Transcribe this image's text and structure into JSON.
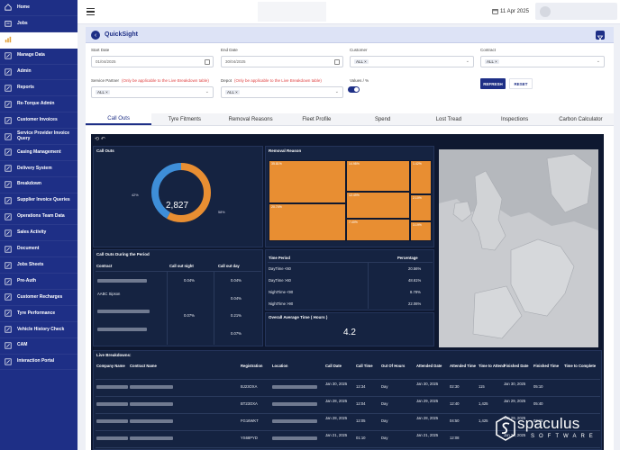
{
  "sidebar": {
    "items": [
      {
        "label": "Home",
        "icon": "home-icon"
      },
      {
        "label": "Jobs",
        "icon": "jobs-icon"
      },
      {
        "label": "",
        "icon": "chart-icon",
        "active": true
      },
      {
        "label": "Manage Data",
        "icon": "edit-icon"
      },
      {
        "label": "Admin",
        "icon": "edit-icon"
      },
      {
        "label": "Reports",
        "icon": "edit-icon"
      },
      {
        "label": "Re-Torque Admin",
        "icon": "edit-icon"
      },
      {
        "label": "Customer Invoices",
        "icon": "edit-icon"
      },
      {
        "label": "Service Provider Invoice Query",
        "icon": "edit-icon"
      },
      {
        "label": "Casing Management",
        "icon": "edit-icon"
      },
      {
        "label": "Delivery System",
        "icon": "edit-icon"
      },
      {
        "label": "Breakdown",
        "icon": "edit-icon"
      },
      {
        "label": "Supplier Invoice Queries",
        "icon": "edit-icon"
      },
      {
        "label": "Operations Team Data",
        "icon": "edit-icon"
      },
      {
        "label": "Sales Activity",
        "icon": "edit-icon"
      },
      {
        "label": "Document",
        "icon": "edit-icon"
      },
      {
        "label": "Jobs Sheets",
        "icon": "edit-icon"
      },
      {
        "label": "Pre-Auth",
        "icon": "edit-icon"
      },
      {
        "label": "Customer Recharges",
        "icon": "edit-icon"
      },
      {
        "label": "Tyre Performance",
        "icon": "edit-icon"
      },
      {
        "label": "Vehicle History Check",
        "icon": "edit-icon"
      },
      {
        "label": "CAM",
        "icon": "edit-icon"
      },
      {
        "label": "Interaction Portal",
        "icon": "edit-icon"
      }
    ]
  },
  "topbar": {
    "date": "11 Apr 2025"
  },
  "quicksight": {
    "title": "QuickSight",
    "filters": {
      "start_date": {
        "label": "Start Date",
        "value": "01/04/2025"
      },
      "end_date": {
        "label": "End Date",
        "value": "30/04/2025"
      },
      "customer": {
        "label": "Customer",
        "chip": "ALL"
      },
      "contract": {
        "label": "Contract",
        "chip": "ALL"
      },
      "service_partner": {
        "label": "Service Partner",
        "hint": "(Only be applicable to the Live Breakdown table)",
        "chip": "ALL"
      },
      "depot": {
        "label": "Depot",
        "hint": "(Only be applicable to the Live Breakdown table)",
        "chip": "ALL"
      },
      "values": {
        "label": "Values / %"
      }
    },
    "refresh_label": "REFRESH",
    "reset_label": "RESET"
  },
  "tabs": [
    "Call Outs",
    "Tyre Fitments",
    "Removal Reasons",
    "Fleet Profile",
    "Spend",
    "Lost Tread",
    "Inspections",
    "Carbon Calculator"
  ],
  "dashboard": {
    "toolbar": "⟲ ↶",
    "callouts": {
      "title": "Call Outs",
      "total": "2,827",
      "left_pct": "42%",
      "right_pct": "58%",
      "left_value": 42,
      "right_value": 58,
      "colors": {
        "left": "#3e8ed8",
        "right": "#e88e32"
      }
    },
    "removal": {
      "title": "Removal Reason",
      "cells": [
        "35.81%",
        "14.98%",
        "7.40%",
        "12.49%",
        "20.74%",
        "3.19%",
        "1.42%",
        "2.10%"
      ]
    },
    "during": {
      "title": "Call Outs During the Period",
      "headers": [
        "Contract",
        "Call out night",
        "Call out day"
      ],
      "rows": [
        {
          "contract": "",
          "night": "0.04%",
          "day": "0.04%"
        },
        {
          "contract": "AABC Sipson",
          "night": "",
          "day": "0.04%"
        },
        {
          "contract": "",
          "night": "0.07%",
          "day": "0.21%"
        },
        {
          "contract": "",
          "night": "",
          "day": "0.07%"
        }
      ]
    },
    "time_period": {
      "headers": [
        "Time Period",
        "Percentage"
      ],
      "rows": [
        {
          "label": "DayTime <60",
          "value": "20.56%"
        },
        {
          "label": "DayTime >60",
          "value": "48.61%"
        },
        {
          "label": "NightTime <90",
          "value": "8.78%"
        },
        {
          "label": "NightTime >90",
          "value": "22.06%"
        }
      ]
    },
    "avg_time": {
      "title": "Overall Average Time ( Hours )",
      "value": "4.2"
    },
    "live": {
      "title": "Live Breakdowns:",
      "headers": [
        "Company Name",
        "Contract Name",
        "Registration",
        "Location",
        "Call Date",
        "Call Time",
        "Out Of Hours",
        "Attended Date",
        "Attended Time",
        "Time to Attend",
        "Finished Date",
        "Finished Time",
        "Time to Complete"
      ],
      "rows": [
        {
          "reg": "BJ23OXA",
          "call_date": "Jan 30, 2025",
          "call_time": "12:34",
          "ooh": "Day",
          "att_date": "Jan 30, 2025",
          "att_time": "02:30",
          "tta": "115",
          "fin_date": "Jan 30, 2025",
          "fin_time": "05:10"
        },
        {
          "reg": "BT23OXA",
          "call_date": "Jan 28, 2025",
          "call_time": "12:04",
          "ooh": "Day",
          "att_date": "Jan 29, 2025",
          "att_time": "12:40",
          "tta": "1,425",
          "fin_date": "Jan 29, 2025",
          "fin_time": "05:40"
        },
        {
          "reg": "FG16WKT",
          "call_date": "Jan 28, 2025",
          "call_time": "12:05",
          "ooh": "Day",
          "att_date": "Jan 28, 2025",
          "att_time": "04:50",
          "tta": "1,425",
          "fin_date": "Jan 29, 2025",
          "fin_time": "03:15"
        },
        {
          "reg": "YS68PYD",
          "call_date": "Jan 21, 2025",
          "call_time": "01:10",
          "ooh": "Day",
          "att_date": "Jan 21, 2025",
          "att_time": "12:08",
          "tta": "",
          "fin_date": "Jan 21, 2025",
          "fin_time": ""
        }
      ]
    }
  },
  "logo": {
    "name": "spaculus",
    "sub": "SOFTWARE"
  }
}
